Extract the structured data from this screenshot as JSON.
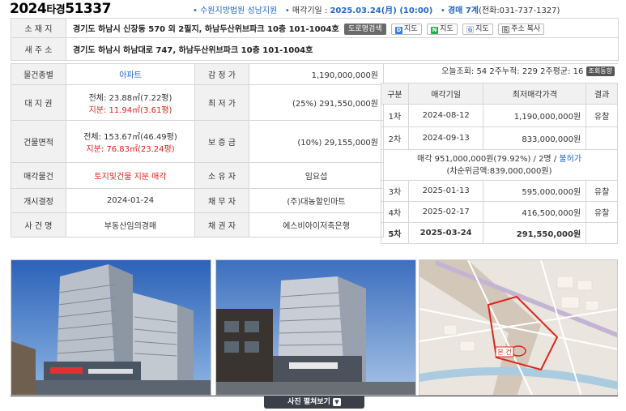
{
  "header": {
    "case_year": "2024",
    "case_type": "타경",
    "case_number": "51337",
    "court": "수원지방법원 성남지원",
    "sale_date_label": "매각기일 :",
    "sale_date": "2025.03.24(月) (10:00)",
    "auction_dept": "경매 7계",
    "phone": "(전화:031-737-1327)"
  },
  "info": {
    "location_label": "소 재 지",
    "location": "경기도 하남시 신장동 570 외 2필지, 하남두산위브파크 10층 101-1004호",
    "road_search_btn": "도로명검색",
    "map_btns": [
      "지도",
      "지도",
      "지도",
      "주소 복사"
    ],
    "new_addr_label": "새 주 소",
    "new_addr": "경기도 하남시 하남대로 747, 하남두산위브파크 10층 101-1004호",
    "type_label": "물건종별",
    "type_value": "아파트",
    "appraisal_label": "감 정 가",
    "appraisal_value": "1,190,000,000원",
    "land_label": "대 지 권",
    "land_total": "전체: 23.88㎡(7.22평)",
    "land_share": "지분: 11.94㎡(3.61평)",
    "min_price_label": "최 저 가",
    "min_price_value": "(25%) 291,550,000원",
    "building_label": "건물면적",
    "building_total": "전체: 153.67㎡(46.49평)",
    "building_share": "지분: 76.83㎡(23.24평)",
    "deposit_label": "보 증 금",
    "deposit_value": "(10%) 29,155,000원",
    "sale_item_label": "매각물건",
    "sale_item_value": "토지및건물 지분 매각",
    "owner_label": "소 유 자",
    "owner_value": "임요섭",
    "decision_label": "개시결정",
    "decision_value": "2024-01-24",
    "debtor_label": "채 무 자",
    "debtor_value": "(주)대농할인마트",
    "case_name_label": "사 건 명",
    "case_name_value": "부동산임의경매",
    "creditor_label": "채 권 자",
    "creditor_value": "에스비아이저축은행"
  },
  "stats": {
    "text": "오늘조회: 54  2주누적: 229  2주평균: 16",
    "button": "조회동향"
  },
  "rounds": {
    "headers": [
      "구분",
      "매각기일",
      "최저매각가격",
      "결과"
    ],
    "rows": [
      {
        "round": "1차",
        "date": "2024-08-12",
        "price": "1,190,000,000원",
        "result": "유찰"
      },
      {
        "round": "2차",
        "date": "2024-09-13",
        "price": "833,000,000원",
        "result": ""
      }
    ],
    "sale_note_prefix": "매각 951,000,000원(79.92%) / 2명 / ",
    "sale_note_link": "불허가",
    "sale_note_2": "(차순위금액:839,000,000원)",
    "rows2": [
      {
        "round": "3차",
        "date": "2025-01-13",
        "price": "595,000,000원",
        "result": "유찰"
      },
      {
        "round": "4차",
        "date": "2025-02-17",
        "price": "416,500,000원",
        "result": "유찰"
      },
      {
        "round": "5차",
        "date": "2025-03-24",
        "price": "291,550,000원",
        "result": ""
      }
    ]
  },
  "photos": {
    "map_label": "본 건",
    "expand_label": "사진 펼쳐보기"
  },
  "colors": {
    "accent_blue": "#2266cc",
    "alert_red": "#e0241b",
    "header_bg": "#f1f1f1"
  }
}
